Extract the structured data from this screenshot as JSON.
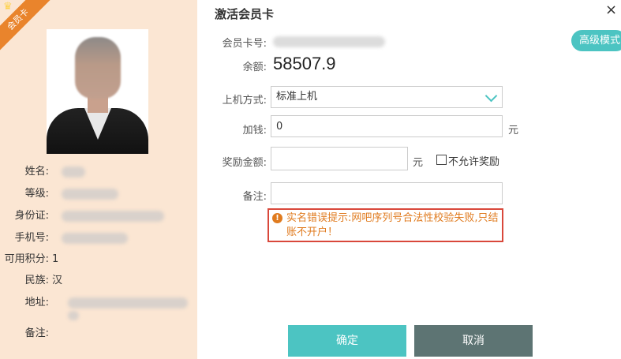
{
  "dialog": {
    "title": "激活会员卡",
    "close_label": "×"
  },
  "badge": {
    "label": "会员卡"
  },
  "member": {
    "fields": [
      {
        "label": "姓名:"
      },
      {
        "label": "等级:"
      },
      {
        "label": "身份证:"
      },
      {
        "label": "手机号:"
      },
      {
        "label": "可用积分:",
        "value": "1"
      },
      {
        "label": "民族:",
        "value": "汉"
      },
      {
        "label": "地址:"
      },
      {
        "label": "备注:"
      }
    ]
  },
  "advanced_button": "高级模式",
  "form": {
    "card_number_label": "会员卡号:",
    "balance_label": "余额:",
    "balance_value": "58507.9",
    "mode_label": "上机方式:",
    "mode_value": "标准上机",
    "add_money_label": "加钱:",
    "add_money_value": "0",
    "add_money_unit": "元",
    "bonus_label": "奖励金额:",
    "bonus_value": "",
    "bonus_unit": "元",
    "no_bonus_label": "不允许奖励",
    "remark_label": "备注:",
    "remark_value": ""
  },
  "error_message": "实名错误提示:网吧序列号合法性校验失败,只结账不开户！",
  "buttons": {
    "confirm": "确定",
    "cancel": "取消"
  },
  "colors": {
    "accent": "#4cc4c2",
    "cancel": "#5d7473",
    "left_panel": "#fbe6d3",
    "error_border": "#d9483b",
    "error_text": "#e07b1f",
    "badge": "#e9842c"
  },
  "icons": {
    "warning": "warning-icon",
    "close": "close-icon",
    "dropdown": "chevron-down-icon",
    "crown": "crown-icon"
  }
}
